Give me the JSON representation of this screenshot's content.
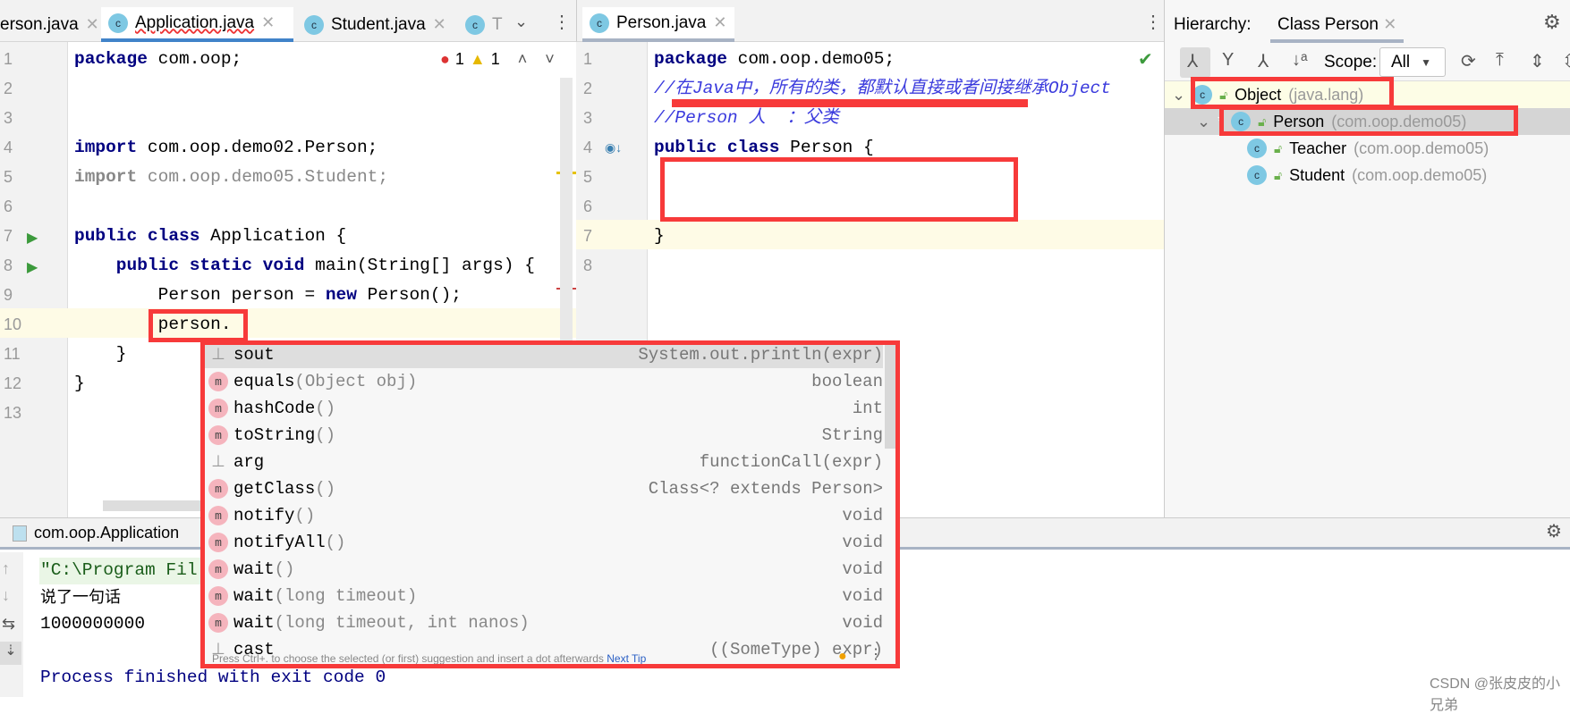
{
  "left_editor": {
    "tabs": [
      {
        "label": "erson.java"
      },
      {
        "label": "Application.java"
      },
      {
        "label": "Student.java"
      },
      {
        "label": "T"
      }
    ],
    "errors": "1",
    "warnings": "1",
    "line_numbers": [
      "1",
      "2",
      "3",
      "4",
      "5",
      "6",
      "7",
      "8",
      "9",
      "10",
      "11",
      "12",
      "13"
    ],
    "lines": [
      [
        {
          "t": "package",
          "c": "kw"
        },
        {
          "t": " com.oop;",
          "c": ""
        }
      ],
      [],
      [],
      [
        {
          "t": "import",
          "c": "kw"
        },
        {
          "t": " com.oop.demo02.Person;",
          "c": ""
        }
      ],
      [
        {
          "t": "import",
          "c": "kw gray"
        },
        {
          "t": " com.oop.demo05.Student;",
          "c": "gray"
        }
      ],
      [],
      [
        {
          "t": "public class",
          "c": "kw"
        },
        {
          "t": " Application {",
          "c": ""
        }
      ],
      [
        {
          "t": "    public static void",
          "c": "kw"
        },
        {
          "t": " main(String[] args) {",
          "c": ""
        }
      ],
      [
        {
          "t": "        Person person = ",
          "c": ""
        },
        {
          "t": "new",
          "c": "kw"
        },
        {
          "t": " Person();",
          "c": ""
        }
      ],
      [
        {
          "t": "        person.",
          "c": ""
        }
      ],
      [
        {
          "t": "    }",
          "c": ""
        }
      ],
      [
        {
          "t": "}",
          "c": ""
        }
      ],
      []
    ]
  },
  "right_editor": {
    "tab": "Person.java",
    "line_numbers": [
      "1",
      "2",
      "3",
      "4",
      "5",
      "6",
      "7",
      "8"
    ],
    "lines": [
      [
        {
          "t": "package",
          "c": "kw"
        },
        {
          "t": " com.oop.demo05;",
          "c": ""
        }
      ],
      [
        {
          "t": "//在Java中，所有的类，都默认直接或者间接继承Object",
          "c": "cm"
        }
      ],
      [
        {
          "t": "//Person 人  ：父类",
          "c": "cm"
        }
      ],
      [
        {
          "t": "public class",
          "c": "kw"
        },
        {
          "t": " Person {",
          "c": ""
        }
      ],
      [],
      [],
      [
        {
          "t": "}",
          "c": ""
        }
      ],
      []
    ]
  },
  "completion": {
    "items": [
      {
        "icon": "template",
        "name": "sout",
        "args": "",
        "type": "System.out.println(expr)"
      },
      {
        "icon": "method",
        "name": "equals",
        "args": "(Object obj)",
        "type": "boolean"
      },
      {
        "icon": "method",
        "name": "hashCode",
        "args": "()",
        "type": "int"
      },
      {
        "icon": "method",
        "name": "toString",
        "args": "()",
        "type": "String"
      },
      {
        "icon": "template",
        "name": "arg",
        "args": "",
        "type": "functionCall(expr)"
      },
      {
        "icon": "method",
        "name": "getClass",
        "args": "()",
        "type": "Class<? extends Person>"
      },
      {
        "icon": "method",
        "name": "notify",
        "args": "()",
        "type": "void"
      },
      {
        "icon": "method",
        "name": "notifyAll",
        "args": "()",
        "type": "void"
      },
      {
        "icon": "method",
        "name": "wait",
        "args": "()",
        "type": "void"
      },
      {
        "icon": "method",
        "name": "wait",
        "args": "(long timeout)",
        "type": "void"
      },
      {
        "icon": "method",
        "name": "wait",
        "args": "(long timeout, int nanos)",
        "type": "void"
      },
      {
        "icon": "template",
        "name": "cast",
        "args": "",
        "type": "((SomeType) expr)"
      }
    ],
    "footer": "Press Ctrl+. to choose the selected (or first) suggestion and insert a dot afterwards",
    "next_tip": "Next Tip"
  },
  "hierarchy": {
    "label": "Hierarchy:",
    "tab": "Class Person",
    "scope_label": "Scope:",
    "scope_value": "All",
    "nodes": [
      {
        "name": "Object",
        "pkg": "(java.lang)"
      },
      {
        "name": "Person",
        "pkg": "(com.oop.demo05)"
      },
      {
        "name": "Teacher",
        "pkg": "(com.oop.demo05)"
      },
      {
        "name": "Student",
        "pkg": "(com.oop.demo05)"
      }
    ]
  },
  "run": {
    "tab": "com.oop.Application",
    "output": [
      "\"C:\\Program Fil",
      "说了一句话",
      "1000000000",
      "",
      "Process finished with exit code 0"
    ]
  },
  "watermark": "CSDN @张皮皮的小兄弟"
}
